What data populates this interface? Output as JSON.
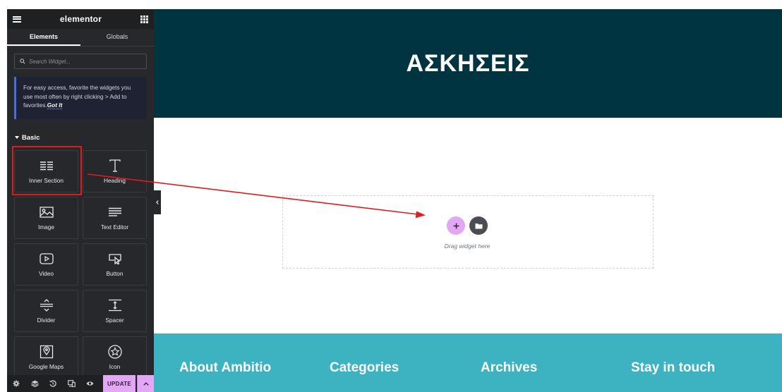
{
  "editor": {
    "brand": "elementor",
    "tabs": [
      {
        "label": "Elements"
      },
      {
        "label": "Globals"
      }
    ],
    "search": {
      "placeholder": "Search Widget..."
    },
    "notice": {
      "text": "For easy access, favorite the widgets you use most often by right clicking > Add to favorites.",
      "link": "Got It"
    },
    "category": "Basic",
    "widgets": [
      {
        "label": "Inner Section",
        "icon": "inner-section-icon",
        "highlighted": true
      },
      {
        "label": "Heading",
        "icon": "heading-icon"
      },
      {
        "label": "Image",
        "icon": "image-icon"
      },
      {
        "label": "Text Editor",
        "icon": "text-editor-icon"
      },
      {
        "label": "Video",
        "icon": "video-icon"
      },
      {
        "label": "Button",
        "icon": "button-icon"
      },
      {
        "label": "Divider",
        "icon": "divider-icon"
      },
      {
        "label": "Spacer",
        "icon": "spacer-icon"
      },
      {
        "label": "Google Maps",
        "icon": "google-maps-icon"
      },
      {
        "label": "Icon",
        "icon": "star-icon"
      }
    ],
    "bottom_icons": [
      "settings-icon",
      "layers-icon",
      "history-icon",
      "responsive-icon",
      "preview-eye-icon"
    ],
    "update_label": "UPDATE"
  },
  "canvas": {
    "hero_title": "ΑΣΚΗΣΕΙΣ",
    "drag_hint": "Drag widget here",
    "footer_columns": [
      {
        "title": "About Ambitio"
      },
      {
        "title": "Categories"
      },
      {
        "title": "Archives"
      },
      {
        "title": "Stay in touch"
      }
    ]
  },
  "colors": {
    "sidebar_bg": "#27282b",
    "hero_bg": "#003441",
    "footer_bg": "#3db2c1",
    "accent_pink": "#e2a8f5",
    "annotation_red": "#e11b1b"
  }
}
